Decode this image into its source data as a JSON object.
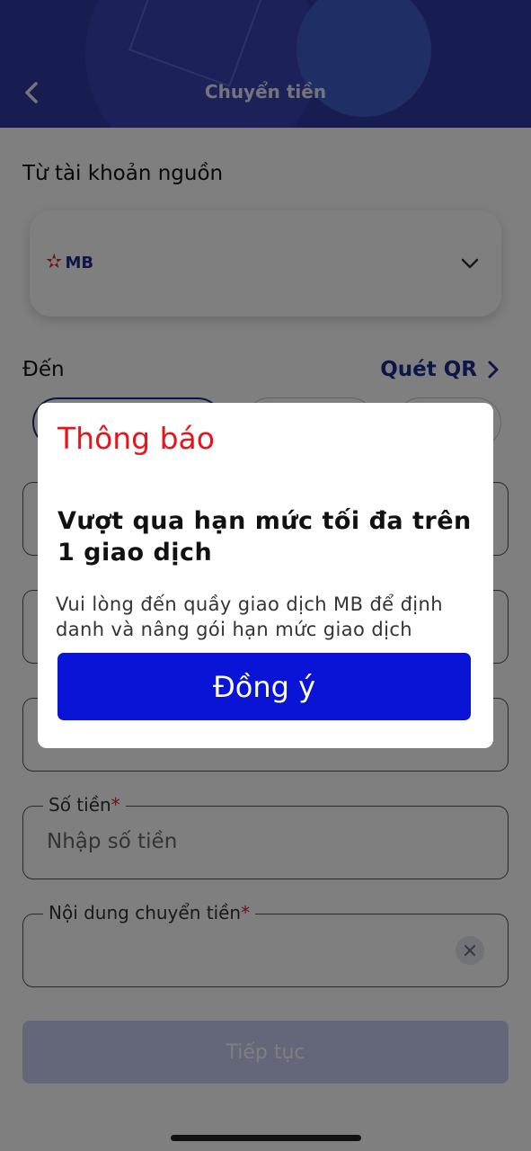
{
  "header": {
    "title": "Chuyển tiền",
    "back_icon": "chevron-left-icon"
  },
  "source": {
    "label": "Từ tài khoản nguồn",
    "bank_logo_text": "MB",
    "dropdown_icon": "chevron-down-icon"
  },
  "destination": {
    "label": "Đến",
    "scan_qr_label": "Quét QR"
  },
  "form": {
    "amount": {
      "label": "Số tiền",
      "required_mark": "*",
      "placeholder": "Nhập số tiền"
    },
    "content": {
      "label": "Nội dung chuyển tiền",
      "required_mark": "*",
      "clear_icon": "close-icon"
    },
    "continue_label": "Tiếp tục"
  },
  "dialog": {
    "title": "Thông báo",
    "heading": "Vượt qua hạn mức tối đa trên 1 giao dịch",
    "message": "Vui lòng đến quầy giao dịch MB để định danh và nâng gói hạn mức giao dịch",
    "confirm_label": "Đồng ý"
  },
  "colors": {
    "brand_primary": "#1c2c8f",
    "dialog_button": "#0a14d6",
    "dialog_title": "#e8141b",
    "required": "#d8232a"
  }
}
